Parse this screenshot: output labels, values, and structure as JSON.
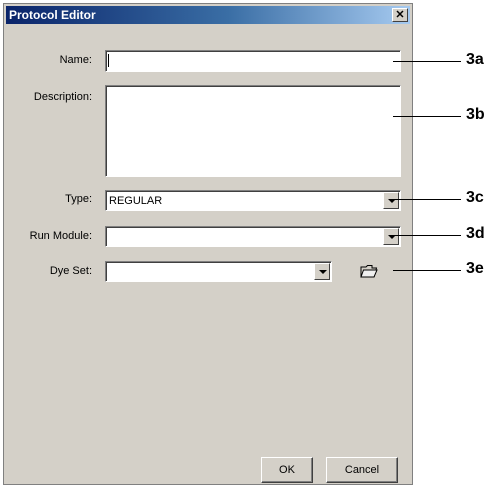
{
  "window": {
    "title": "Protocol Editor",
    "close_symbol": "✕"
  },
  "form": {
    "name_label": "Name:",
    "name_value": "",
    "description_label": "Description:",
    "description_value": "",
    "type_label": "Type:",
    "type_value": "REGULAR",
    "run_module_label": "Run Module:",
    "run_module_value": "",
    "dye_set_label": "Dye Set:",
    "dye_set_value": ""
  },
  "buttons": {
    "ok": "OK",
    "cancel": "Cancel"
  },
  "callouts": [
    "3a",
    "3b",
    "3c",
    "3d",
    "3e"
  ]
}
